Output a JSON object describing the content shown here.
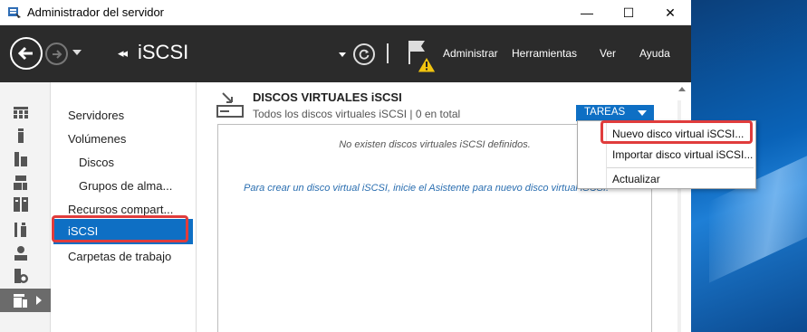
{
  "window": {
    "title": "Administrador del servidor",
    "controls": {
      "minimize": "—",
      "maximize": "☐",
      "close": "✕"
    }
  },
  "header": {
    "breadcrumb_arrows": "◂◂",
    "page_title": "iSCSI",
    "menu": [
      "Administrar",
      "Herramientas",
      "Ver",
      "Ayuda"
    ]
  },
  "rail": {
    "icons": [
      "dashboard-icon",
      "server-icon",
      "all-servers-icon",
      "file-services-icon",
      "storage-icon",
      "tools-icon",
      "user-storage-icon",
      "backup-icon",
      "file-storage-icon"
    ]
  },
  "sidebar": {
    "items": [
      {
        "label": "Servidores",
        "sub": false
      },
      {
        "label": "Volúmenes",
        "sub": false
      },
      {
        "label": "Discos",
        "sub": true
      },
      {
        "label": "Grupos de alma...",
        "sub": true
      },
      {
        "label": "Recursos compart...",
        "sub": false
      },
      {
        "label": "iSCSI",
        "sub": false,
        "selected": true
      },
      {
        "label": "Carpetas de trabajo",
        "sub": false
      }
    ]
  },
  "section": {
    "title": "DISCOS VIRTUALES iSCSI",
    "subtitle": "Todos los discos virtuales iSCSI | 0 en total",
    "tasks_button": "TAREAS",
    "empty_message": "No existen discos virtuales iSCSI definidos.",
    "wizard_link": "Para crear un disco virtual iSCSI, inicie el Asistente para nuevo disco virtual iSCSI."
  },
  "dropdown": {
    "items": [
      "Nuevo disco virtual iSCSI...",
      "Importar disco virtual iSCSI...",
      "Actualizar"
    ]
  },
  "colors": {
    "header_bg": "#2b2b2b",
    "accent": "#0e6fc4",
    "highlight_red": "#e03c3c",
    "warning_yellow": "#f2c40f"
  }
}
